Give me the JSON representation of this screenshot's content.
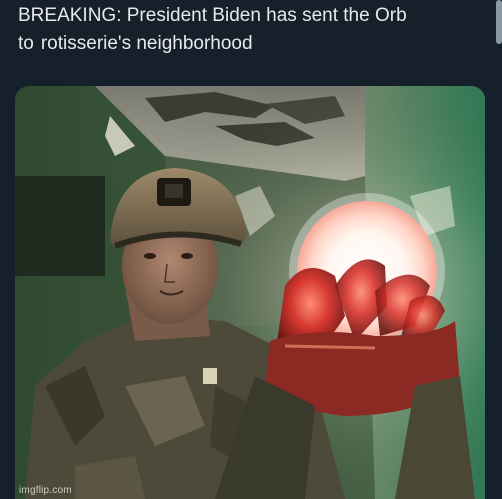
{
  "tweet": {
    "line1": "BREAKING: President Biden has sent the Orb",
    "line2_prefix": "to",
    "line2_rest": "rotisserie's neighborhood"
  },
  "watermark": "imgflip.com",
  "colors": {
    "background": "#15202b",
    "text": "#e7e9ea",
    "orb_glow": "#ffffff",
    "hand_glow": "#e0403a"
  }
}
